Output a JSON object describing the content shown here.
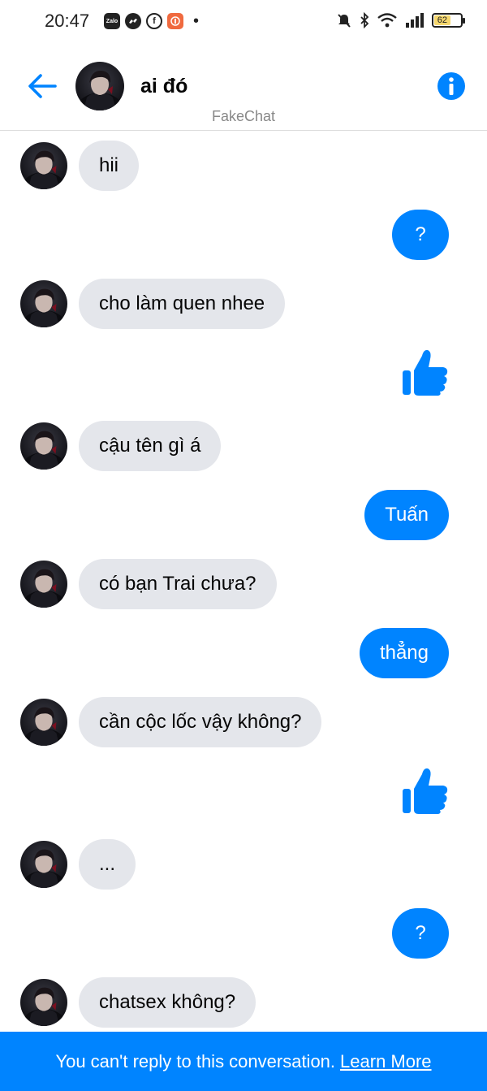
{
  "status_bar": {
    "time": "20:47",
    "app_icons": [
      "zalo-icon",
      "messenger-icon",
      "facebook-icon",
      "audio-app-icon"
    ],
    "battery_level": "62"
  },
  "header": {
    "contact_name": "ai đó",
    "subtitle": "FakeChat"
  },
  "messages": [
    {
      "from": "them",
      "type": "text",
      "text": "hii"
    },
    {
      "from": "me",
      "type": "text",
      "text": "?"
    },
    {
      "from": "them",
      "type": "text",
      "text": "cho làm quen nhee"
    },
    {
      "from": "me",
      "type": "like"
    },
    {
      "from": "them",
      "type": "text",
      "text": "cậu tên gì á"
    },
    {
      "from": "me",
      "type": "text",
      "text": "Tuấn"
    },
    {
      "from": "them",
      "type": "text",
      "text": "có bạn Trai chưa?"
    },
    {
      "from": "me",
      "type": "text",
      "text": "thẳng"
    },
    {
      "from": "them",
      "type": "text",
      "text": "cần cộc lốc vậy không?"
    },
    {
      "from": "me",
      "type": "like"
    },
    {
      "from": "them",
      "type": "text",
      "text": "..."
    },
    {
      "from": "me",
      "type": "text",
      "text": "?"
    },
    {
      "from": "them",
      "type": "text",
      "text": "chatsex không?"
    }
  ],
  "footer": {
    "notice": "You can't reply to this conversation.",
    "link": "Learn More"
  },
  "colors": {
    "accent": "#0084ff",
    "incoming_bubble": "#e4e6eb"
  }
}
